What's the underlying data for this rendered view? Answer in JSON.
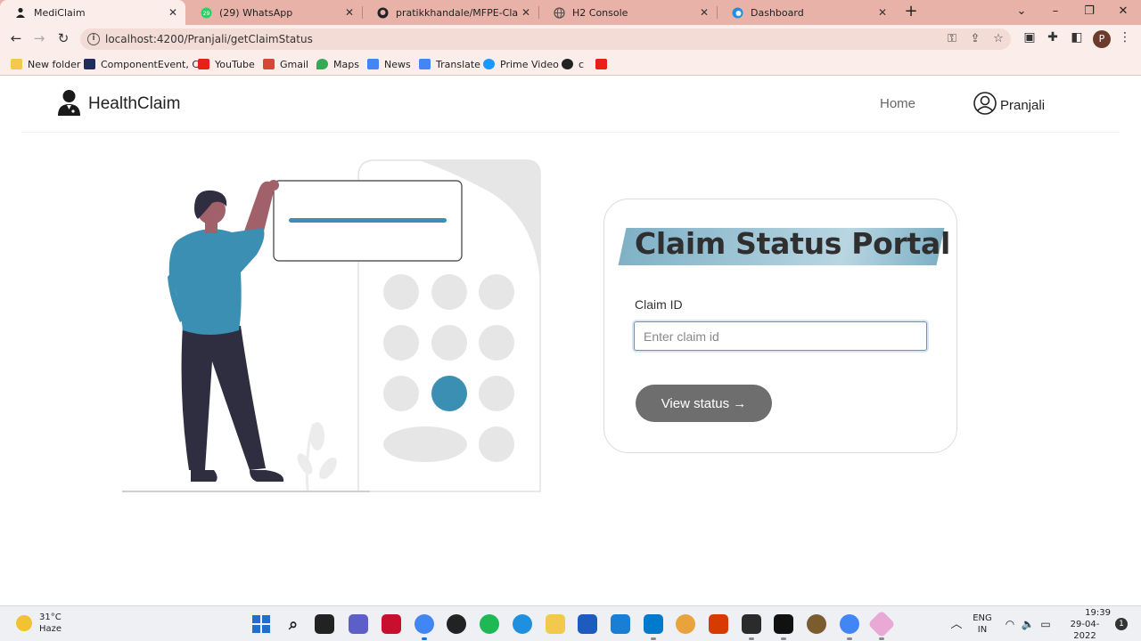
{
  "browser": {
    "tabs": [
      {
        "title": "MediClaim",
        "icon": "mediclaim-favicon"
      },
      {
        "title": "(29) WhatsApp",
        "icon": "whatsapp-favicon"
      },
      {
        "title": "pratikkhandale/MFPE-Claim-Man",
        "icon": "github-favicon"
      },
      {
        "title": "H2 Console",
        "icon": "h2-favicon"
      },
      {
        "title": "Dashboard",
        "icon": "edge-favicon"
      }
    ],
    "url": "localhost:4200/Pranjali/getClaimStatus",
    "profile_initial": "P",
    "bookmarks": [
      {
        "label": "New folder",
        "color": "#f2c94c"
      },
      {
        "label": "ComponentEvent, C...",
        "color": "#1f2d5c"
      },
      {
        "label": "YouTube",
        "color": "#e62117"
      },
      {
        "label": "Gmail",
        "color": "#d44638"
      },
      {
        "label": "Maps",
        "color": "#34a853"
      },
      {
        "label": "News",
        "color": "#4285f4"
      },
      {
        "label": "Translate",
        "color": "#4285f4"
      },
      {
        "label": "Prime Video",
        "color": "#1a98ff"
      },
      {
        "label": "c",
        "color": "#222222"
      },
      {
        "label": "",
        "color": "#e62117"
      }
    ]
  },
  "app": {
    "brand": "HealthClaim",
    "nav_home": "Home",
    "user_name": "Pranjali",
    "card": {
      "title": "Claim Status Portal",
      "field_label": "Claim ID",
      "placeholder": "Enter claim id",
      "button_label": "View status →"
    },
    "colors": {
      "accent": "#3a8fb2",
      "button": "#6e6e6e"
    }
  },
  "taskbar": {
    "temperature": "31°C",
    "condition": "Haze",
    "language_line1": "ENG",
    "language_line2": "IN",
    "time": "19:39",
    "date": "29-04-2022",
    "notification_count": "1"
  }
}
